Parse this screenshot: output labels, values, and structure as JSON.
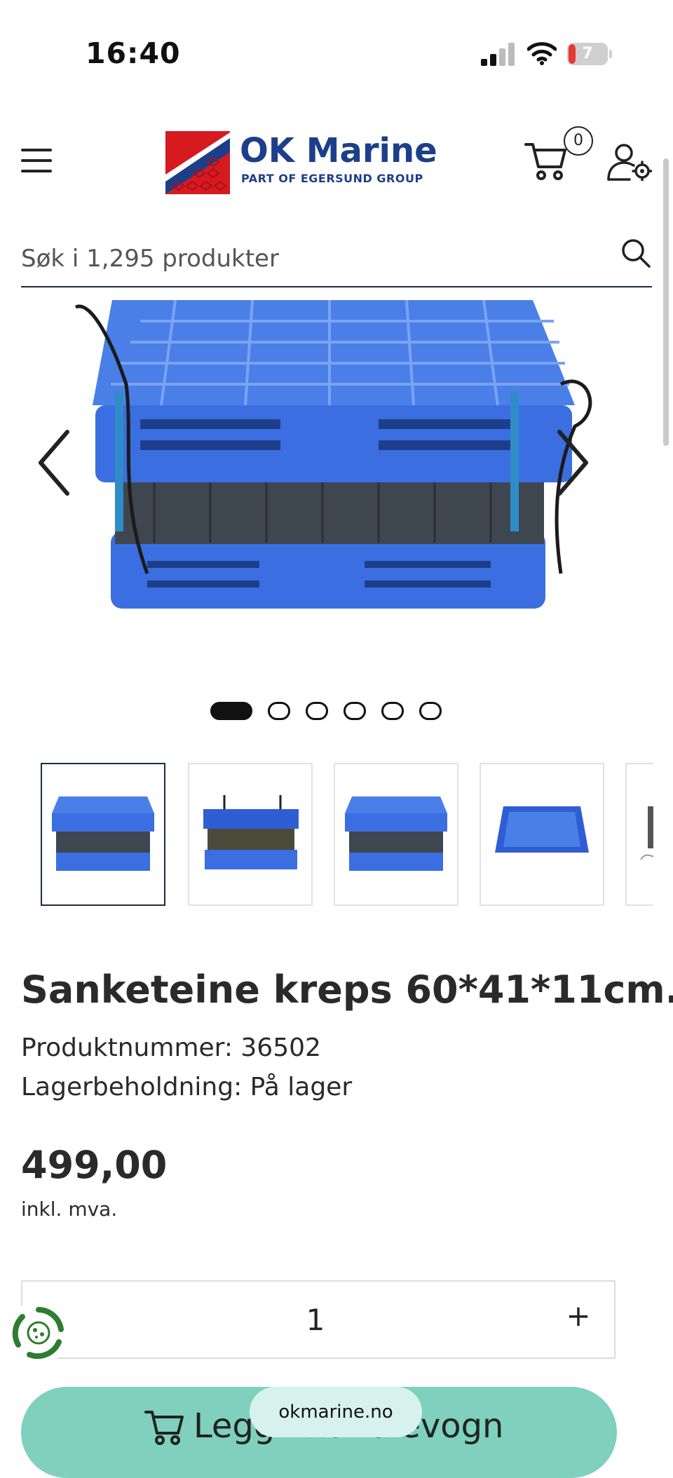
{
  "status_bar": {
    "time": "16:40",
    "battery": "7"
  },
  "header": {
    "brand_name": "OK Marine",
    "brand_tagline": "PART OF EGERSUND GROUP",
    "cart_count": "0",
    "icons": {
      "menu": "hamburger-menu-icon",
      "cart": "shopping-cart-icon",
      "account": "user-settings-icon",
      "search": "search-icon"
    }
  },
  "search": {
    "placeholder": "Søk i 1,295 produkter"
  },
  "gallery": {
    "slide_count": 6,
    "active_slide": 1,
    "thumbnail_count": 5
  },
  "product": {
    "title": "Sanketeine kreps 60*41*11cm.",
    "product_number": "Produktnummer: 36502",
    "stock": "Lagerbeholdning: På lager",
    "price": "499,00",
    "vat_note": "inkl. mva."
  },
  "quantity": {
    "value": "1",
    "plus_label": "+"
  },
  "add_to_cart": {
    "label": "Legg i handlevogn"
  },
  "browser": {
    "url": "okmarine.no"
  },
  "colors": {
    "accent_button": "#7fd1bd",
    "brand_blue": "#1d3f8a",
    "crate_blue": "#3b6ee0"
  }
}
